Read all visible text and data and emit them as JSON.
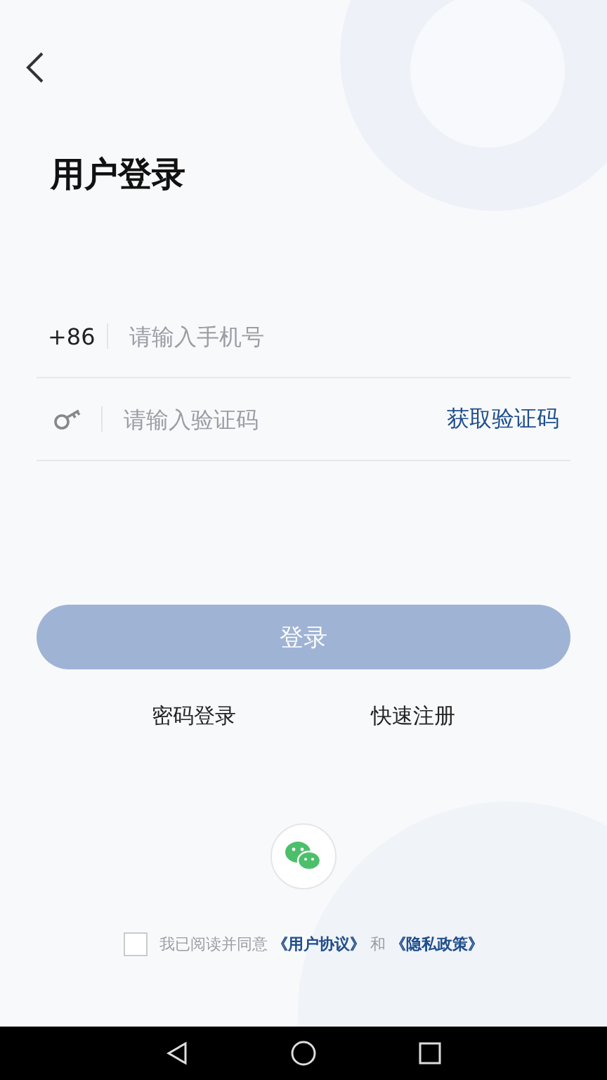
{
  "title": "用户登录",
  "phone_field": {
    "prefix": "+86",
    "placeholder": "请输入手机号"
  },
  "code_field": {
    "placeholder": "请输入验证码",
    "action": "获取验证码"
  },
  "login_button": {
    "label": "登录",
    "disabled": true
  },
  "links": [
    {
      "label": "密码登录"
    },
    {
      "label": "快速注册"
    }
  ],
  "agreement": {
    "checked": false,
    "text": "我已阅读并同意",
    "link_1": "《用户协议》",
    "joiner": "和",
    "link_2": "《隐私政策》"
  }
}
